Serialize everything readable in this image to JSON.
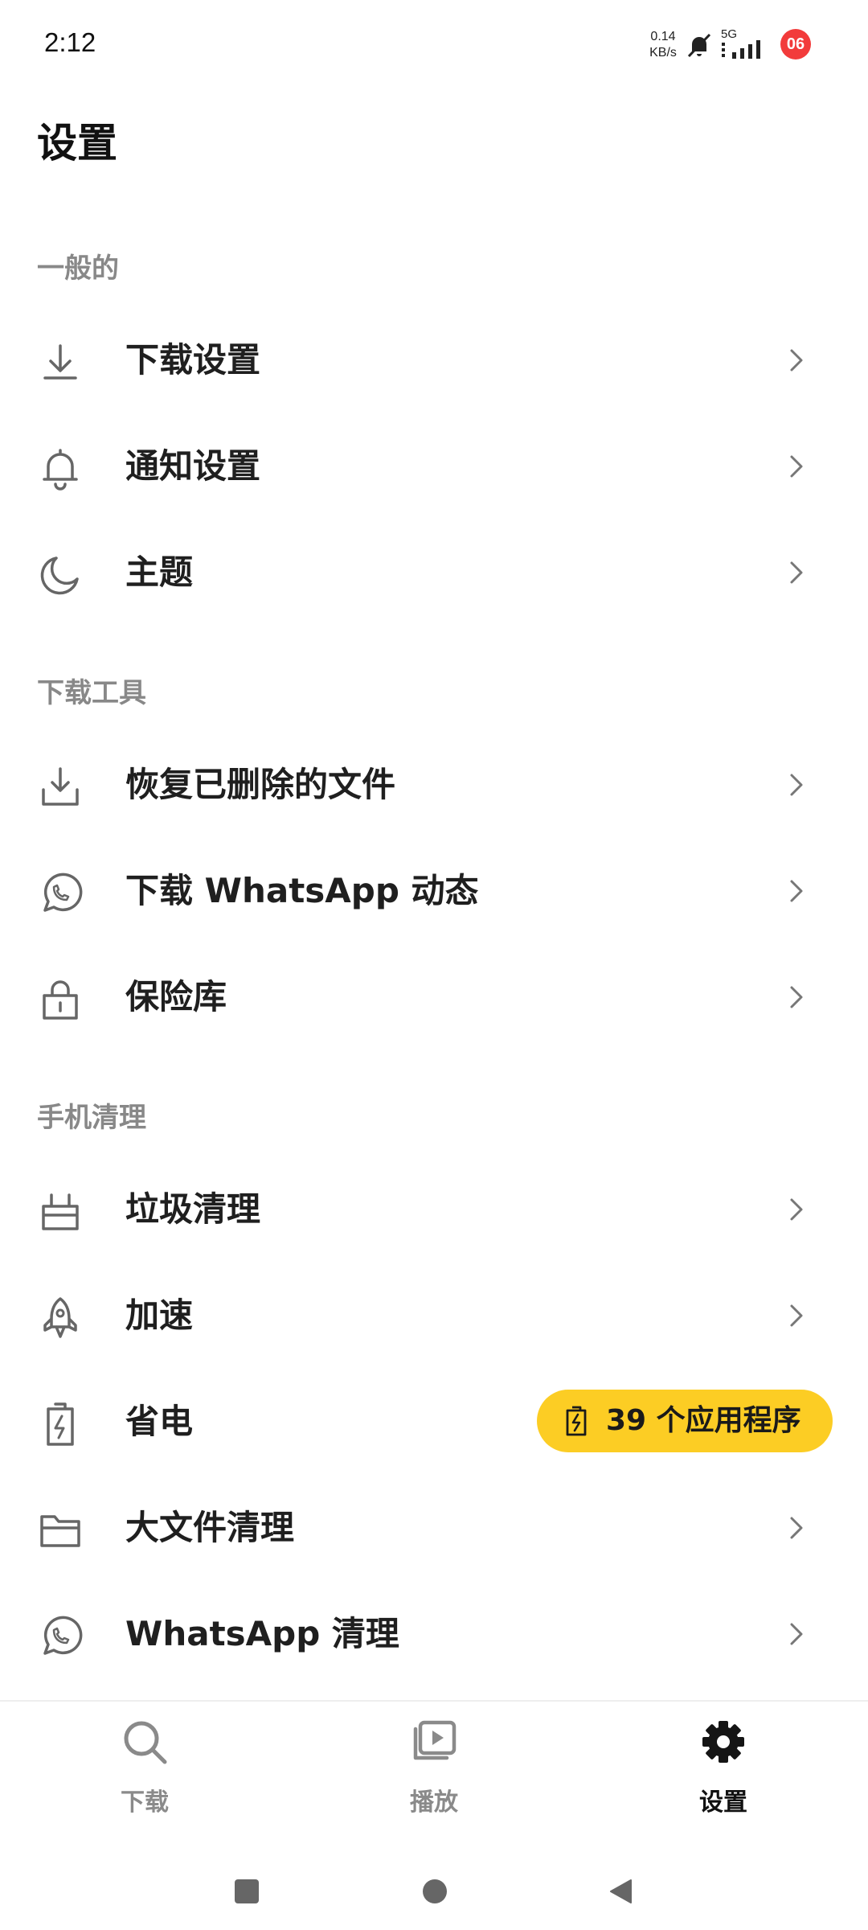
{
  "status_bar": {
    "time": "2:12",
    "net_speed_value": "0.14",
    "net_speed_unit": "KB/s",
    "network_type": "5G",
    "battery_badge": "06"
  },
  "page": {
    "title": "设置"
  },
  "sections": [
    {
      "header": "一般的",
      "items": [
        {
          "label": "下载设置",
          "icon": "download-icon"
        },
        {
          "label": "通知设置",
          "icon": "bell-icon"
        },
        {
          "label": "主题",
          "icon": "moon-icon"
        }
      ]
    },
    {
      "header": "下载工具",
      "items": [
        {
          "label": "恢复已删除的文件",
          "icon": "tray-download-icon"
        },
        {
          "label": "下载 WhatsApp 动态",
          "icon": "whatsapp-icon"
        },
        {
          "label": "保险库",
          "icon": "lock-icon"
        }
      ]
    },
    {
      "header": "手机清理",
      "items": [
        {
          "label": "垃圾清理",
          "icon": "basket-icon"
        },
        {
          "label": "加速",
          "icon": "rocket-icon"
        },
        {
          "label": "省电",
          "icon": "battery-icon",
          "badge": "39 个应用程序"
        },
        {
          "label": "大文件清理",
          "icon": "folder-icon"
        },
        {
          "label": "WhatsApp 清理",
          "icon": "whatsapp-icon"
        }
      ]
    }
  ],
  "bottom_nav": {
    "tabs": [
      {
        "label": "下载",
        "icon": "search-icon",
        "active": false
      },
      {
        "label": "播放",
        "icon": "media-stack-icon",
        "active": false
      },
      {
        "label": "设置",
        "icon": "gear-icon",
        "active": true
      }
    ]
  },
  "colors": {
    "accent": "#fccd24",
    "badge": "#f23b3b",
    "section_text": "#888888",
    "icon": "#666666"
  }
}
